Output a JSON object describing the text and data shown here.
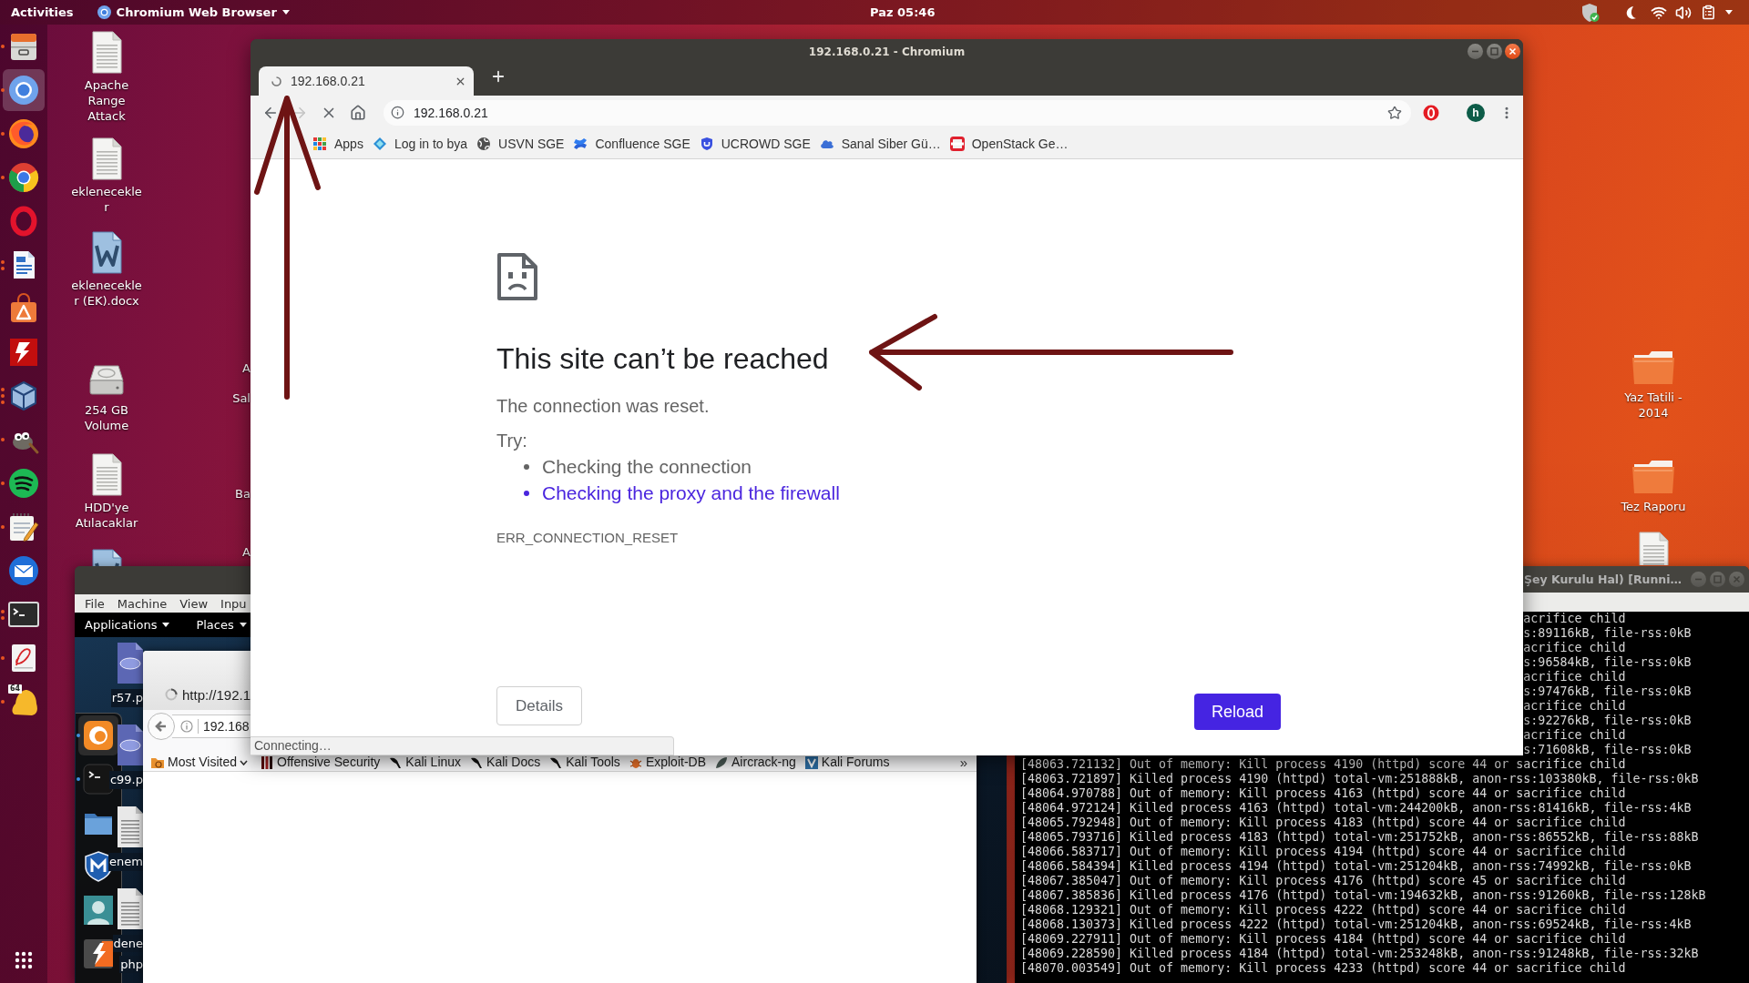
{
  "top_bar": {
    "activities": "Activities",
    "app_menu": "Chromium Web Browser",
    "clock": "Paz 05:46"
  },
  "dock": {
    "items": [
      {
        "kind": "files",
        "selected": false,
        "windows": [
          {
            "kind": "dot"
          }
        ]
      },
      {
        "kind": "chromium",
        "selected": true,
        "windows": [
          {
            "kind": "dot"
          }
        ]
      },
      {
        "kind": "firefox",
        "selected": false,
        "windows": [
          {
            "kind": "dot"
          }
        ]
      },
      {
        "kind": "chrome",
        "selected": false,
        "windows": [
          {
            "kind": "dot"
          }
        ]
      },
      {
        "kind": "opera",
        "selected": false
      },
      {
        "kind": "writer",
        "selected": false,
        "windows": [
          {
            "kind": "dot"
          },
          {
            "kind": "dot"
          }
        ]
      },
      {
        "kind": "software",
        "selected": false
      },
      {
        "kind": "filezilla",
        "selected": false
      },
      {
        "kind": "virtualbox",
        "selected": false,
        "windows": [
          {
            "kind": "dot"
          },
          {
            "kind": "dot"
          },
          {
            "kind": "dot"
          }
        ]
      },
      {
        "kind": "gimp",
        "selected": false,
        "windows": [
          {
            "kind": "dot"
          }
        ]
      },
      {
        "kind": "spotify",
        "selected": false,
        "windows": [
          {
            "kind": "dot"
          }
        ]
      },
      {
        "kind": "notes",
        "selected": false,
        "windows": [
          {
            "kind": "dot"
          }
        ]
      },
      {
        "kind": "mail",
        "selected": false
      },
      {
        "kind": "terminal",
        "selected": false,
        "windows": [
          {
            "kind": "dot"
          },
          {
            "kind": "dot"
          }
        ]
      },
      {
        "kind": "viewer",
        "selected": false,
        "windows": [
          {
            "kind": "dot"
          }
        ]
      },
      {
        "kind": "bell",
        "selected": false,
        "windows": [
          {
            "kind": "dot"
          }
        ],
        "badge": "64"
      }
    ]
  },
  "desktop": {
    "left_icons": [
      {
        "kind": "document",
        "label": "Apache Range Attack"
      },
      {
        "kind": "document",
        "label": "eklenecekler"
      },
      {
        "kind": "word",
        "label": "eklenecekler (EK).docx"
      },
      {
        "kind": "drive",
        "label": "254 GB Volume"
      },
      {
        "kind": "document",
        "label": "HDD'ye Atılacaklar"
      }
    ],
    "partial_icon": {
      "kind": "word"
    },
    "cut_labels": [
      "A",
      "Sal",
      "Ba",
      "A"
    ],
    "right_icons": [
      {
        "kind": "folder",
        "label": "Yaz Tatili - 2014"
      },
      {
        "kind": "folder",
        "label": "Tez Raporu"
      },
      {
        "kind": "document"
      }
    ]
  },
  "browser": {
    "title": "192.168.0.21 - Chromium",
    "tab": {
      "title": "192.168.0.21",
      "loading": true
    },
    "toolbar": {
      "buttons": [
        {
          "kind": "back",
          "disabled": false
        },
        {
          "kind": "forward",
          "disabled": true
        },
        {
          "kind": "stop",
          "disabled": false
        },
        {
          "kind": "home",
          "disabled": false
        }
      ],
      "url": "192.168.0.21",
      "bookmarked": false,
      "avatar": "h"
    },
    "bookmarks": [
      {
        "kind": "apps",
        "label": "Apps"
      },
      {
        "kind": "bya",
        "label": "Log in to bya"
      },
      {
        "kind": "globe",
        "label": "USVN SGE"
      },
      {
        "kind": "confluence",
        "label": "Confluence SGE"
      },
      {
        "kind": "shield",
        "label": "UCROWD SGE"
      },
      {
        "kind": "cloud",
        "label": "Sanal Siber Gü…"
      },
      {
        "kind": "openstack",
        "label": "OpenStack Ge…"
      }
    ],
    "error_page": {
      "heading": "This site can’t be reached",
      "message": "The connection was reset.",
      "try_label": "Try:",
      "suggestions": [
        {
          "text": "Checking the connection",
          "link": false
        },
        {
          "text": "Checking the proxy and the firewall",
          "link": true
        }
      ],
      "error_code": "ERR_CONNECTION_RESET",
      "details_button": "Details",
      "reload_button": "Reload"
    },
    "status_bubble": "Connecting…"
  },
  "annotations": [
    {
      "kind": "arrow_up"
    },
    {
      "kind": "arrow_left"
    }
  ],
  "vm_kali": {
    "menu": [
      "File",
      "Machine",
      "View",
      "Inpu"
    ],
    "panel": [
      "Applications",
      "Places"
    ],
    "dock": [
      {
        "kind": "firefox",
        "selected": true,
        "running": true
      },
      {
        "kind": "terminal",
        "selected": false,
        "running": true
      },
      {
        "kind": "folder",
        "selected": false,
        "running": false
      },
      {
        "kind": "metasploit",
        "selected": false,
        "running": false
      },
      {
        "kind": "avatar",
        "selected": false,
        "running": false
      },
      {
        "kind": "burp",
        "selected": false,
        "running": false
      }
    ],
    "desktop_icons": [
      {
        "kind": "php",
        "lines": [
          "r57.p"
        ]
      },
      {
        "kind": "php",
        "lines": [
          "c99.p"
        ]
      },
      {
        "kind": "text",
        "lines": [
          "enem"
        ]
      },
      {
        "kind": "text",
        "lines": [
          "dene",
          "php"
        ]
      }
    ],
    "firefox": {
      "tab": "http://192.1",
      "url": "192.168",
      "bookmarks": [
        {
          "kind": "folder",
          "label": "Most Visited",
          "menu": true
        },
        {
          "kind": "offsec",
          "label": "Offensive Security"
        },
        {
          "kind": "kali",
          "label": "Kali Linux"
        },
        {
          "kind": "kali",
          "label": "Kali Docs"
        },
        {
          "kind": "kali",
          "label": "Kali Tools"
        },
        {
          "kind": "exploitdb",
          "label": "Exploit-DB"
        },
        {
          "kind": "aircrack",
          "label": "Aircrack-ng"
        },
        {
          "kind": "forums",
          "label": "Kali Forums"
        }
      ],
      "overflow": "»"
    }
  },
  "vm_console": {
    "title": "Şey Kurulu Hal) [Runni…",
    "lines": [
      {
        "kind": "partial",
        "text": "acrifice child"
      },
      {
        "kind": "partial",
        "text": "s:89116kB, file-rss:0kB"
      },
      {
        "kind": "partial",
        "text": "acrifice child"
      },
      {
        "kind": "partial",
        "text": "s:96584kB, file-rss:0kB"
      },
      {
        "kind": "partial",
        "text": "acrifice child"
      },
      {
        "kind": "partial",
        "text": "s:97476kB, file-rss:0kB"
      },
      {
        "kind": "partial",
        "text": "acrifice child"
      },
      {
        "kind": "partial",
        "text": "s:92276kB, file-rss:0kB"
      },
      {
        "kind": "partial",
        "text": "acrifice child"
      },
      {
        "kind": "partial",
        "text": "s:71608kB, file-rss:0kB"
      },
      {
        "kind": "full",
        "text": "[48063.721132] Out of memory: Kill process 4190 (httpd) score 44 or sacrifice child"
      },
      {
        "kind": "full",
        "text": "[48063.721897] Killed process 4190 (httpd) total-vm:251888kB, anon-rss:103380kB, file-rss:0kB"
      },
      {
        "kind": "full",
        "text": "[48064.970788] Out of memory: Kill process 4163 (httpd) score 44 or sacrifice child"
      },
      {
        "kind": "full",
        "text": "[48064.972124] Killed process 4163 (httpd) total-vm:244200kB, anon-rss:81416kB, file-rss:4kB"
      },
      {
        "kind": "full",
        "text": "[48065.792948] Out of memory: Kill process 4183 (httpd) score 44 or sacrifice child"
      },
      {
        "kind": "full",
        "text": "[48065.793716] Killed process 4183 (httpd) total-vm:251752kB, anon-rss:86552kB, file-rss:88kB"
      },
      {
        "kind": "full",
        "text": "[48066.583717] Out of memory: Kill process 4194 (httpd) score 44 or sacrifice child"
      },
      {
        "kind": "full",
        "text": "[48066.584394] Killed process 4194 (httpd) total-vm:251204kB, anon-rss:74992kB, file-rss:0kB"
      },
      {
        "kind": "full",
        "text": "[48067.385047] Out of memory: Kill process 4176 (httpd) score 45 or sacrifice child"
      },
      {
        "kind": "full",
        "text": "[48067.385836] Killed process 4176 (httpd) total-vm:194632kB, anon-rss:91260kB, file-rss:128kB"
      },
      {
        "kind": "full",
        "text": "[48068.129321] Out of memory: Kill process 4222 (httpd) score 44 or sacrifice child"
      },
      {
        "kind": "full",
        "text": "[48068.130373] Killed process 4222 (httpd) total-vm:251204kB, anon-rss:69524kB, file-rss:4kB"
      },
      {
        "kind": "full",
        "text": "[48069.227911] Out of memory: Kill process 4184 (httpd) score 44 or sacrifice child"
      },
      {
        "kind": "full",
        "text": "[48069.228590] Killed process 4184 (httpd) total-vm:253248kB, anon-rss:91248kB, file-rss:32kB"
      },
      {
        "kind": "full",
        "text": "[48070.003549] Out of memory: Kill process 4233 (httpd) score 44 or sacrifice child"
      }
    ]
  }
}
